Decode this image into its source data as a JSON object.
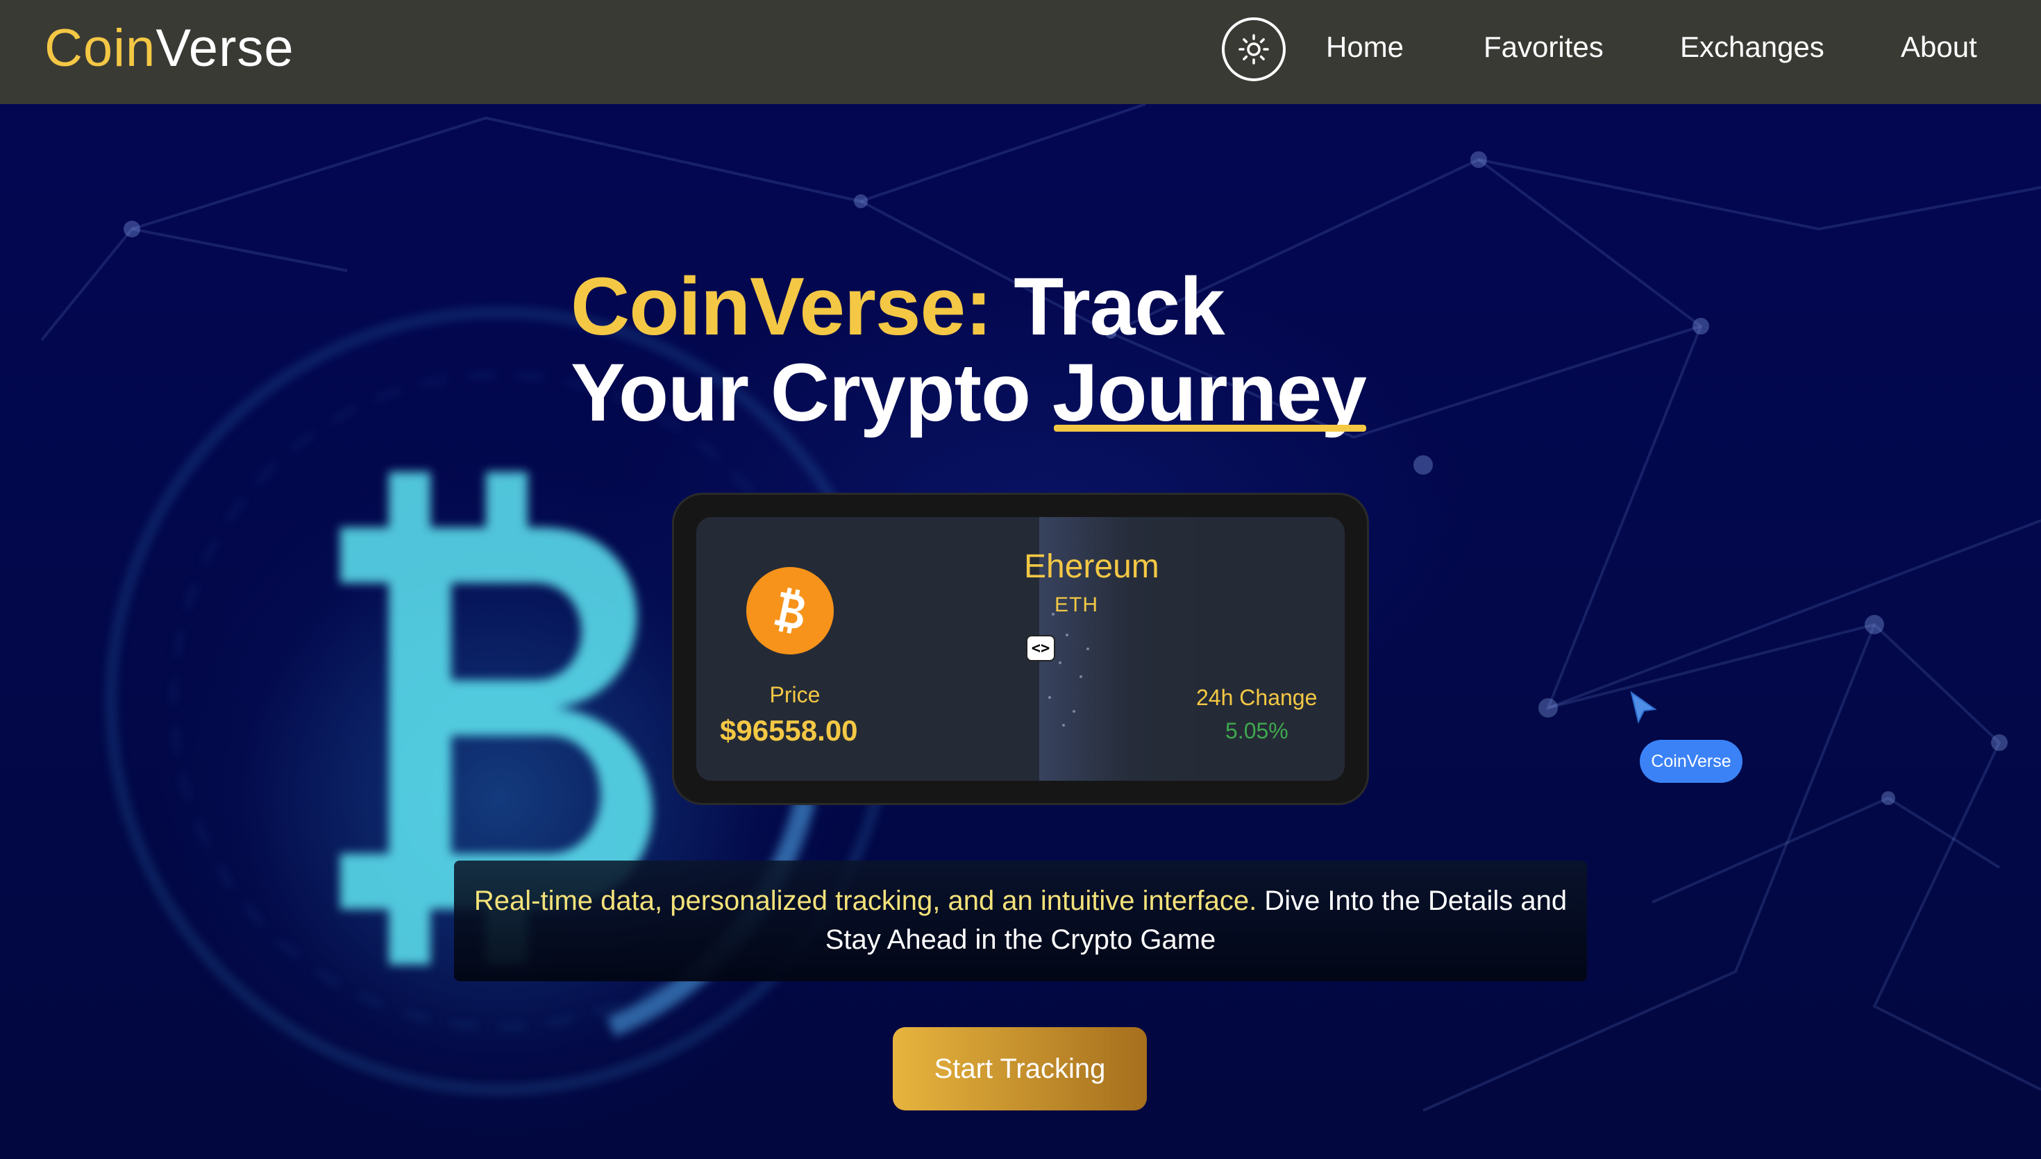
{
  "brand": {
    "part1": "Coin",
    "part2": "Verse"
  },
  "nav": {
    "theme_icon": "sun-icon",
    "links": [
      "Home",
      "Favorites",
      "Exchanges",
      "About"
    ]
  },
  "hero": {
    "title_gold": "CoinVerse:",
    "title_line1_rest": "Track",
    "title_line2_plain": "Your Crypto",
    "title_line2_underlined": "Journey"
  },
  "card": {
    "coin_icon": "bitcoin-icon",
    "price_label": "Price",
    "price_value": "$96558.00",
    "coin_name": "Ehereum",
    "coin_symbol": "ETH",
    "change_label": "24h Change",
    "change_value": "5.05%",
    "slider_label": "<>"
  },
  "tagline": {
    "highlight": "Real-time data, personalized tracking, and an intuitive interface.",
    "rest": " Dive Into the Details and Stay Ahead in the Crypto Game"
  },
  "cta": {
    "label": "Start Tracking"
  },
  "cursor_tag": {
    "label": "CoinVerse"
  },
  "colors": {
    "accent": "#f4c845",
    "nav_bg": "#3a3a35",
    "hero_bg": "#03074a",
    "positive": "#3fa94f",
    "bitcoin": "#f7931a",
    "cursor_blue": "#3b82f6"
  }
}
